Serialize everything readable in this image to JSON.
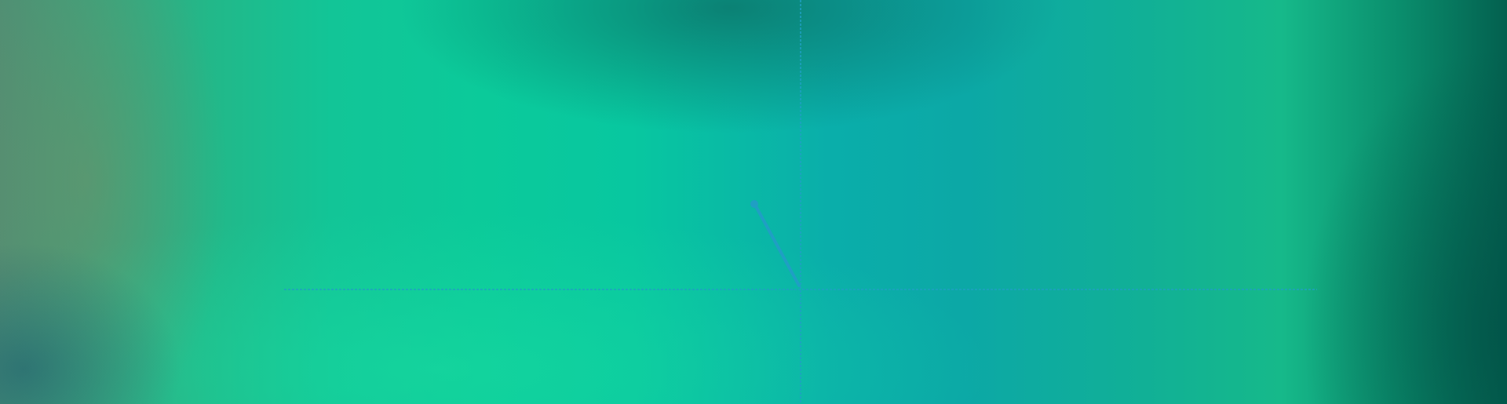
{
  "background": {
    "description_colors": [
      "#4f8f74",
      "#12c597",
      "#0aaeaa",
      "#16b98a",
      "#03604f"
    ]
  },
  "crosshair": {
    "color": "#1f9fc4"
  },
  "pointer": {
    "color": "#1f9fc4"
  }
}
